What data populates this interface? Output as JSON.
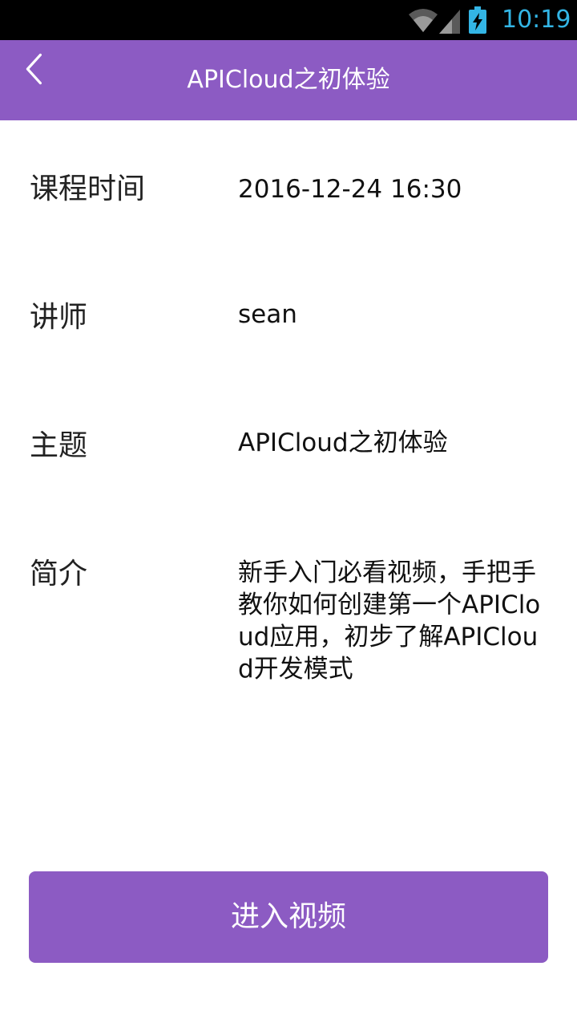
{
  "status_bar": {
    "time": "10:19",
    "icons": [
      "wifi-icon",
      "signal-icon",
      "battery-charging-icon"
    ],
    "clock_color": "#33b5e5"
  },
  "header": {
    "title": "APICloud之初体验",
    "back_icon": "chevron-left-icon",
    "background_color": "#8c5bc3"
  },
  "details": {
    "time": {
      "label": "课程时间",
      "value": "2016-12-24 16:30"
    },
    "teacher": {
      "label": "讲师",
      "value": "sean"
    },
    "topic": {
      "label": "主题",
      "value": "APICloud之初体验"
    },
    "intro": {
      "label": "简介",
      "value": "新手入门必看视频，手把手教你如何创建第一个APICloud应用，初步了解APICloud开发模式"
    }
  },
  "actions": {
    "enter_video_label": "进入视频",
    "button_color": "#8c5bc3"
  }
}
